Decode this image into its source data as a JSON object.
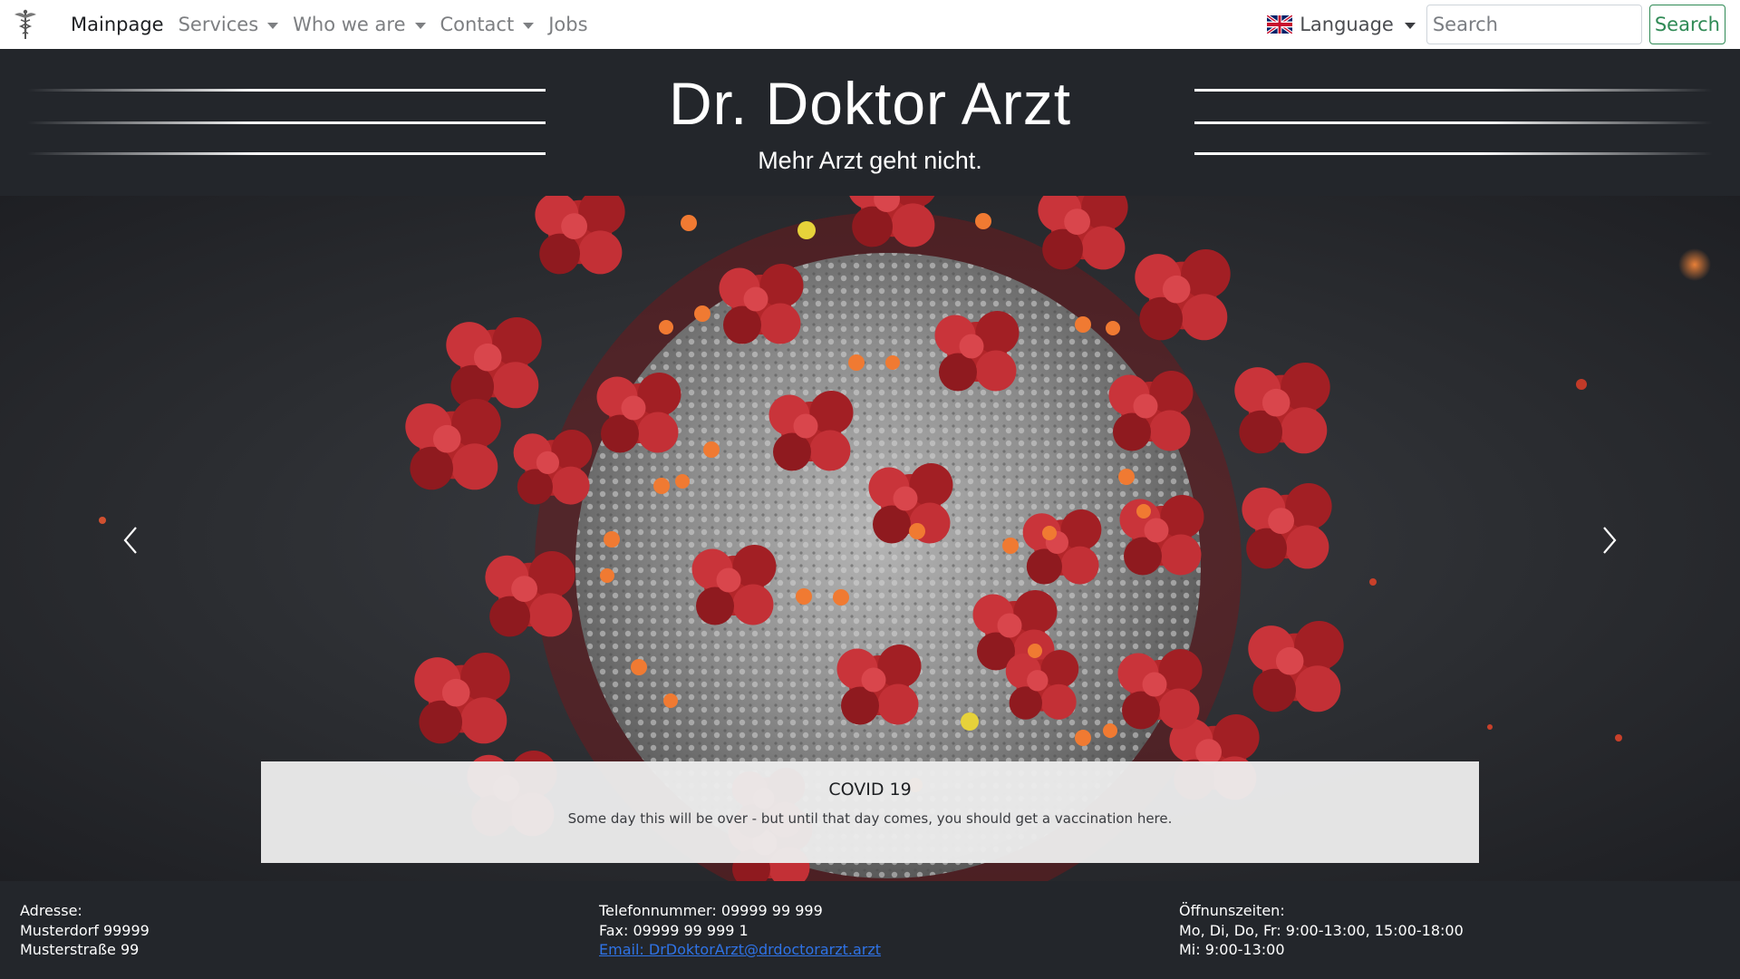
{
  "navbar": {
    "logo_icon": "caduceus-icon",
    "items": [
      {
        "label": "Mainpage",
        "dropdown": false,
        "active": true
      },
      {
        "label": "Services",
        "dropdown": true,
        "active": false
      },
      {
        "label": "Who we are",
        "dropdown": true,
        "active": false
      },
      {
        "label": "Contact",
        "dropdown": true,
        "active": false
      },
      {
        "label": "Jobs",
        "dropdown": false,
        "active": false
      }
    ],
    "language": {
      "label": "Language",
      "flag_icon": "uk-flag-icon"
    },
    "search": {
      "placeholder": "Search",
      "value": "",
      "button_label": "Search"
    }
  },
  "header": {
    "title": "Dr. Doktor Arzt",
    "subtitle": "Mehr Arzt geht nicht."
  },
  "carousel": {
    "image": "coronavirus-illustration",
    "prev_icon": "chevron-left-icon",
    "next_icon": "chevron-right-icon",
    "caption": {
      "title": "COVID 19",
      "text": "Some day this will be over - but until that day comes, you should get a vaccination here."
    }
  },
  "footer": {
    "address": {
      "heading": "Adresse:",
      "line1": "Musterdorf 99999",
      "line2": "Musterstraße 99"
    },
    "contact": {
      "phone": "Telefonnummer: 09999 99 999",
      "fax": "Fax: 09999 99 999 1",
      "email": "Email: DrDoktorArzt@drdoctorarzt.arzt"
    },
    "hours": {
      "heading": "Öffnunszeiten:",
      "line1": "Mo, Di, Do, Fr: 9:00-13:00, 15:00-18:00",
      "line2": "Mi: 9:00-13:00"
    }
  },
  "colors": {
    "dark_background": "#23262b",
    "search_button": "#2f8a55",
    "link": "#2f73e6",
    "virus_spike": "#b3262a",
    "virus_body": "#8e8e8e"
  }
}
